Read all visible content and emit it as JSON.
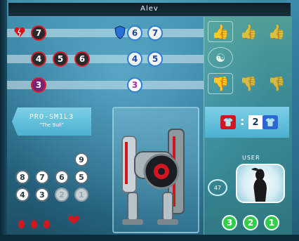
{
  "header": {
    "player_name": "Alev"
  },
  "rows": [
    {
      "id": "row-1",
      "icon": "broken-heart-icon",
      "red_values": [
        "7"
      ],
      "blue_icon": "shield-icon",
      "blue_values": [
        "6",
        "7"
      ],
      "votes": [
        {
          "icon": "thumbs-up-icon",
          "active": true
        },
        {
          "icon": "thumbs-up-icon",
          "active": false
        },
        {
          "icon": "thumbs-up-icon",
          "active": false
        }
      ]
    },
    {
      "id": "row-2",
      "red_values": [
        "4",
        "5",
        "6"
      ],
      "blue_values": [
        "4",
        "5"
      ],
      "votes": [
        {
          "icon": "thumbs-up-down-icon",
          "active": true
        }
      ]
    },
    {
      "id": "row-3",
      "red_values": [
        "3"
      ],
      "blue_values": [
        "3"
      ],
      "votes": [
        {
          "icon": "thumbs-down-icon",
          "active": true
        },
        {
          "icon": "thumbs-down-icon",
          "active": false
        },
        {
          "icon": "thumbs-down-icon",
          "active": false
        }
      ]
    }
  ],
  "player_card": {
    "title": "PRO-SM1L3",
    "subtitle": "\"The Bull\""
  },
  "number_grid": {
    "row_1": [
      "9"
    ],
    "row_2": [
      "8",
      "7",
      "6",
      "5"
    ],
    "row_3": [
      "4",
      "3",
      "2",
      "1"
    ]
  },
  "lives": {
    "drops": 3,
    "icon": "heart-icon"
  },
  "trade": {
    "separator": ":",
    "count": "2"
  },
  "user": {
    "label": "USER",
    "score": "47",
    "silhouette_icon": "woman-silhouette-icon"
  },
  "green_tokens": [
    "3",
    "2",
    "1"
  ],
  "colors": {
    "red": "#d8202a",
    "blue": "#2a7fd6",
    "green": "#2fcf4a",
    "gold": "#d9b24a"
  }
}
